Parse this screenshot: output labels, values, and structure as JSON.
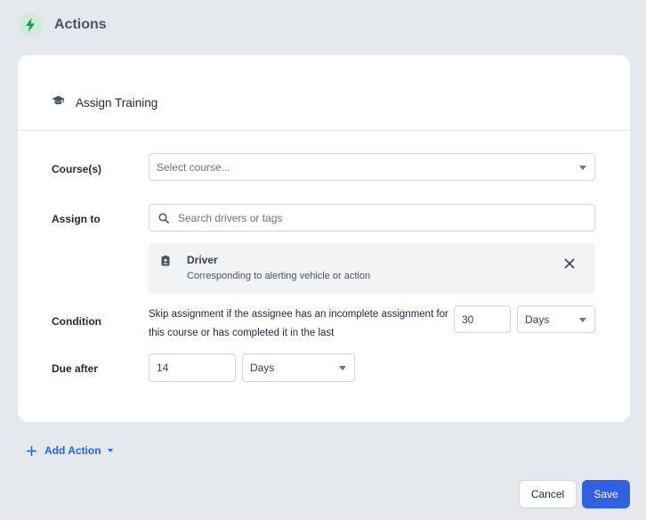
{
  "header": {
    "title": "Actions",
    "icon": "lightning-bolt-icon",
    "accent": "#18a34a"
  },
  "action": {
    "title": "Assign Training",
    "icon": "graduation-cap-icon",
    "course": {
      "label": "Course(s)",
      "placeholder": "Select course..."
    },
    "assign_to": {
      "label": "Assign to",
      "search_placeholder": "Search drivers or tags",
      "selected": {
        "title": "Driver",
        "subtitle": "Corresponding to alerting vehicle or action",
        "icon": "id-badge-icon"
      }
    },
    "condition": {
      "label": "Condition",
      "text": "Skip assignment if the assignee has an incomplete assignment for this course or has completed it in the last",
      "value": "30",
      "unit": "Days"
    },
    "due_after": {
      "label": "Due after",
      "value": "14",
      "unit": "Days"
    }
  },
  "add_action": {
    "label": "Add Action"
  },
  "footer": {
    "cancel_label": "Cancel",
    "save_label": "Save",
    "save_color": "#3061e3"
  }
}
